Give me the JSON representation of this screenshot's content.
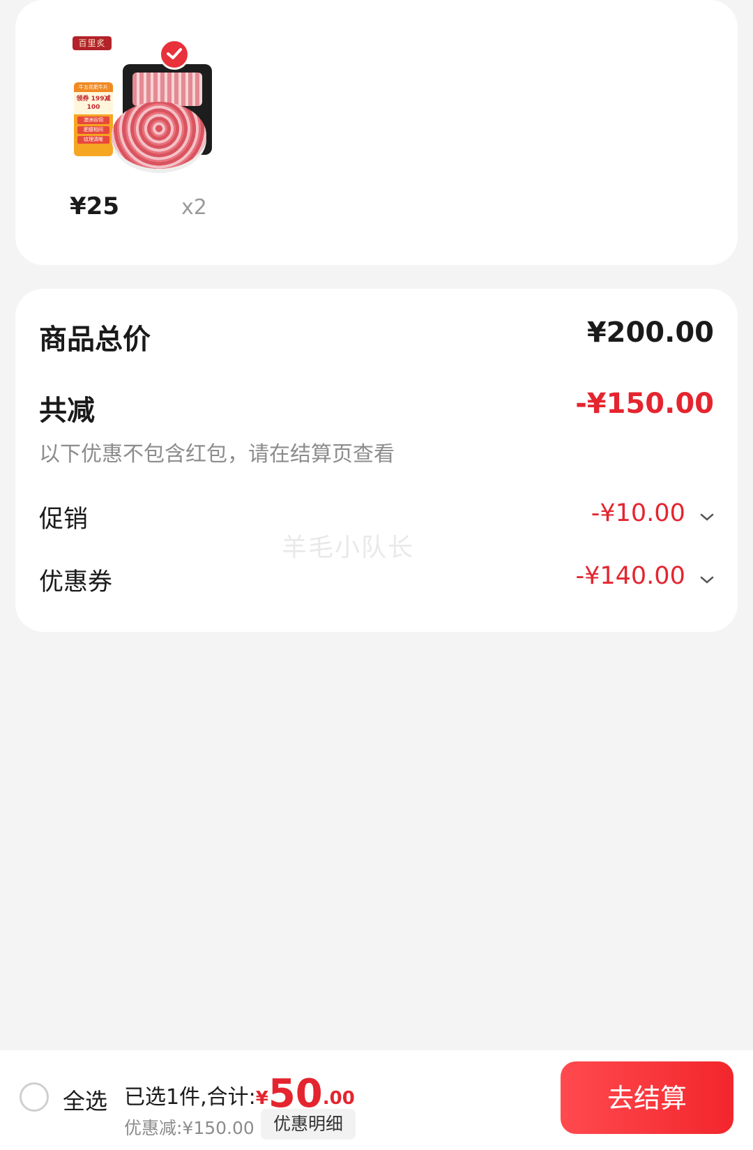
{
  "product": {
    "brand_tag": "百里炙",
    "promo_sticker": {
      "top": "牛五花肥牛片",
      "mid": "领券 199减100",
      "rows": [
        "澳洲谷饲",
        "肥瘦相间",
        "纹理清晰"
      ]
    },
    "selected": true,
    "price": "¥25",
    "quantity": "x2"
  },
  "summary": {
    "total_label": "商品总价",
    "total_value": "¥200.00",
    "reduction_label": "共减",
    "reduction_value": "-¥150.00",
    "note": "以下优惠不包含红包，请在结算页查看",
    "promo_label": "促销",
    "promo_value": "-¥10.00",
    "coupon_label": "优惠券",
    "coupon_value": "-¥140.00"
  },
  "watermark": "羊毛小队长",
  "bottom_bar": {
    "select_all": "全选",
    "selected_text": "已选1件,合计:",
    "currency": "¥",
    "total_int": "50",
    "total_dec": ".00",
    "discount_text": "优惠减:¥150.00",
    "detail_button": "优惠明细",
    "checkout_button": "去结算"
  },
  "colors": {
    "accent": "#e4252f",
    "background": "#f4f4f4"
  }
}
